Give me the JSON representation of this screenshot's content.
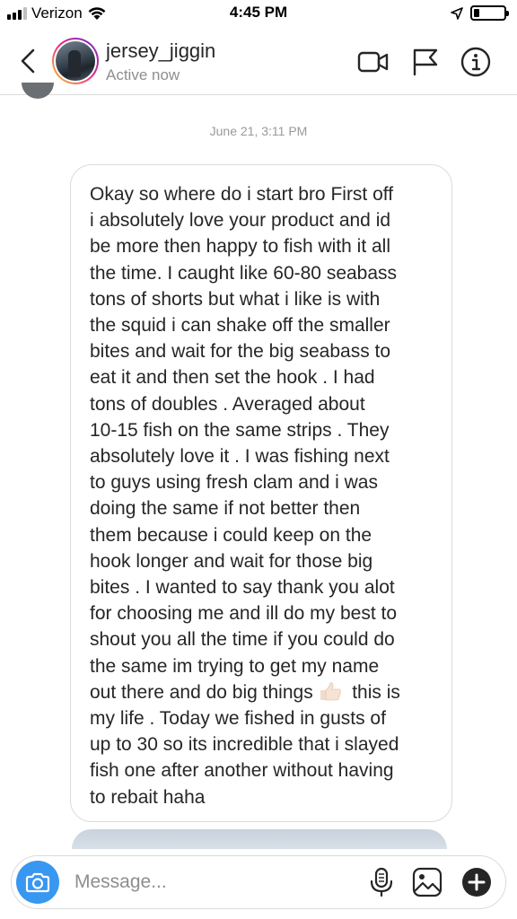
{
  "status_bar": {
    "carrier": "Verizon",
    "time": "4:45 PM",
    "signal_bars": 3,
    "battery_level": 0.2
  },
  "header": {
    "username": "jersey_jiggin",
    "active_status": "Active now",
    "icons": [
      "back-chevron-icon",
      "video-call-icon",
      "flag-icon",
      "info-icon"
    ],
    "avatar_ring_colors": [
      "#f9ce34",
      "#ee2a7b",
      "#6228d7"
    ]
  },
  "conversation": {
    "timestamp": "June 21, 3:11 PM",
    "message_lines": [
      "Okay so where do i start bro First off",
      "i absolutely love your product and id",
      "be more then happy to fish with it all",
      "the time. I caught like 60-80 seabass",
      "tons of shorts but what i like is with",
      "the squid i can shake off the smaller",
      "bites and wait for the big seabass to",
      "eat it and then set the hook . I had",
      "tons of doubles . Averaged about",
      "10-15 fish on the same strips . They",
      "absolutely love it . I was fishing next",
      "to guys using fresh clam and i was",
      "doing the same if not better then",
      "them because i could keep on the",
      "hook longer and wait for those big",
      "bites . I wanted to say thank you alot",
      "for choosing me and ill do my best to",
      "shout you all the time if you could do",
      "the same im trying to get my name",
      "out there and do big things",
      "my life . Today we fished in gusts of",
      "up to 30 so its incredible that i slayed",
      "fish one after another without having",
      "to rebait haha"
    ],
    "line_20_tail": "this is",
    "emoji": "thumbs-up-light-skin-icon"
  },
  "composer": {
    "placeholder": "Message...",
    "icons": [
      "camera-icon",
      "microphone-icon",
      "gallery-icon",
      "plus-icon"
    ],
    "accent_color": "#3897f0"
  }
}
